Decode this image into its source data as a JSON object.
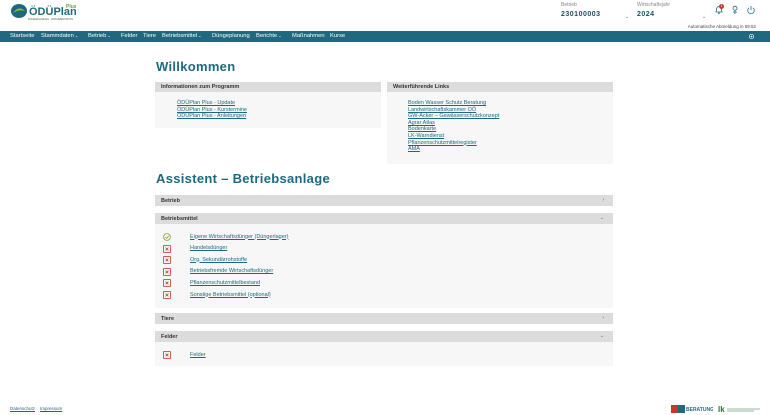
{
  "header": {
    "logo_alt": "ÖDÜPlan Plus",
    "logo_tagline": "DÜNGEPLANUNG · DOKUMENTATION",
    "betrieb_label": "Betrieb",
    "betrieb_value": "230100003",
    "wirtschaftsjahr_label": "Wirtschaftsjahr",
    "wirtschaftsjahr_value": "2024",
    "notification_count": "1",
    "logout_note": "Automatische Abmeldung in 59:52",
    "icons": [
      "bell-icon",
      "user-icon",
      "power-icon"
    ]
  },
  "nav": {
    "items": [
      {
        "label": "Startseite",
        "caret": false
      },
      {
        "label": "Stammdaten",
        "caret": true
      },
      {
        "label": "Betrieb",
        "caret": true
      },
      {
        "label": "Felder",
        "caret": false
      },
      {
        "label": "Tiere",
        "caret": false
      },
      {
        "label": "Betriebsmittel",
        "caret": true
      },
      {
        "label": "Düngeplanung",
        "caret": false
      },
      {
        "label": "Berichte",
        "caret": true
      },
      {
        "label": "Maßnahmen",
        "caret": false
      },
      {
        "label": "Kurse",
        "caret": false
      }
    ],
    "caret_symbol": "⌄",
    "settings_icon": "gear-icon"
  },
  "welcome": {
    "title": "Willkommen",
    "info_title": "Informationen zum Programm",
    "info_links": [
      "ÖDÜPlan Plus - Update",
      "ÖDÜPlan Plus - Kurstermine",
      "ÖDÜPlan Plus - Anleitungen"
    ],
    "more_title": "Weiterführende Links",
    "more_links": [
      "Boden Wasser Schutz Beratung",
      "Landwirtschaftskammer OÖ",
      "GW-Acker – Gewässerschutzkonzept",
      "Agrar Atlas",
      "Bodenkarte",
      "LK-Warndienst",
      "Pflanzenschutzmittelregister",
      "AMA"
    ]
  },
  "assistant": {
    "title": "Assistent – Betriebsanlage",
    "sections": {
      "betrieb": {
        "label": "Betrieb",
        "chevron": "›"
      },
      "betriebsmittel": {
        "label": "Betriebsmittel",
        "chevron": "⌄"
      },
      "tiere": {
        "label": "Tiere",
        "chevron": "›"
      },
      "felder": {
        "label": "Felder",
        "chevron": "⌄"
      }
    },
    "betriebsmittel_items": [
      {
        "label": "Eigene Wirtschaftsdünger (Düngerlager)",
        "status": "done"
      },
      {
        "label": "Handelsdünger",
        "status": "missing"
      },
      {
        "label": "Org. Sekundärrohstoffe",
        "status": "missing"
      },
      {
        "label": "Betriebsfremde Wirtschaftsdünger",
        "status": "missing"
      },
      {
        "label": "Pflanzenschutzmittelbestand",
        "status": "missing"
      },
      {
        "label": "Sonstige Betriebsmittel (optional)",
        "status": "missing"
      }
    ],
    "felder_items": [
      {
        "label": "Felder",
        "status": "missing"
      }
    ]
  },
  "footer": {
    "links": [
      "Datenschutz",
      "Impressum"
    ],
    "partner_logos": [
      "BWSB Beratung",
      "LK Oberösterreich"
    ]
  },
  "colors": {
    "primary": "#1f6980",
    "done": "#8a9a2b",
    "missing": "#c0392b",
    "header_gray": "#dcdcdc"
  }
}
